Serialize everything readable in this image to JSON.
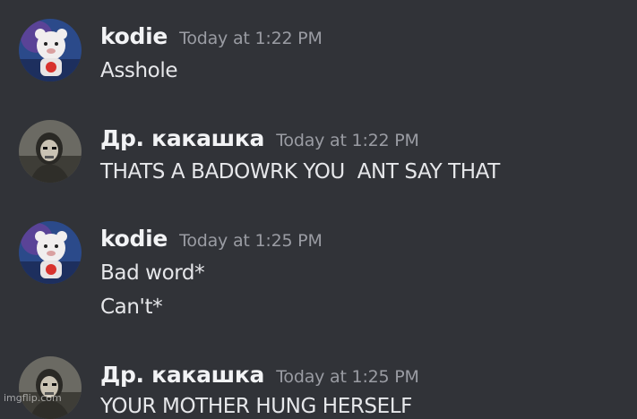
{
  "messages": [
    {
      "author": "kodie",
      "timestamp": "Today at 1:22 PM",
      "avatar": "kodie-avatar",
      "lines": [
        "Asshole"
      ]
    },
    {
      "author": "Др. какашка",
      "timestamp": "Today at 1:22 PM",
      "avatar": "masked-soldier-avatar",
      "lines": [
        "THATS A BADOWRK YOU  ANT SAY THAT"
      ]
    },
    {
      "author": "kodie",
      "timestamp": "Today at 1:25 PM",
      "avatar": "kodie-avatar",
      "lines": [
        "Bad word*",
        "Can't*"
      ]
    },
    {
      "author": "Др. какашка",
      "timestamp": "Today at 1:25 PM",
      "avatar": "masked-soldier-avatar",
      "lines": [
        "YOUR MOTHER HUNG HERSELF"
      ]
    }
  ],
  "watermark": "imgflip.com",
  "colors": {
    "background": "#313338",
    "username": "#f2f3f5",
    "timestamp": "#9a9ca3",
    "message_text": "#e6e7ea"
  }
}
